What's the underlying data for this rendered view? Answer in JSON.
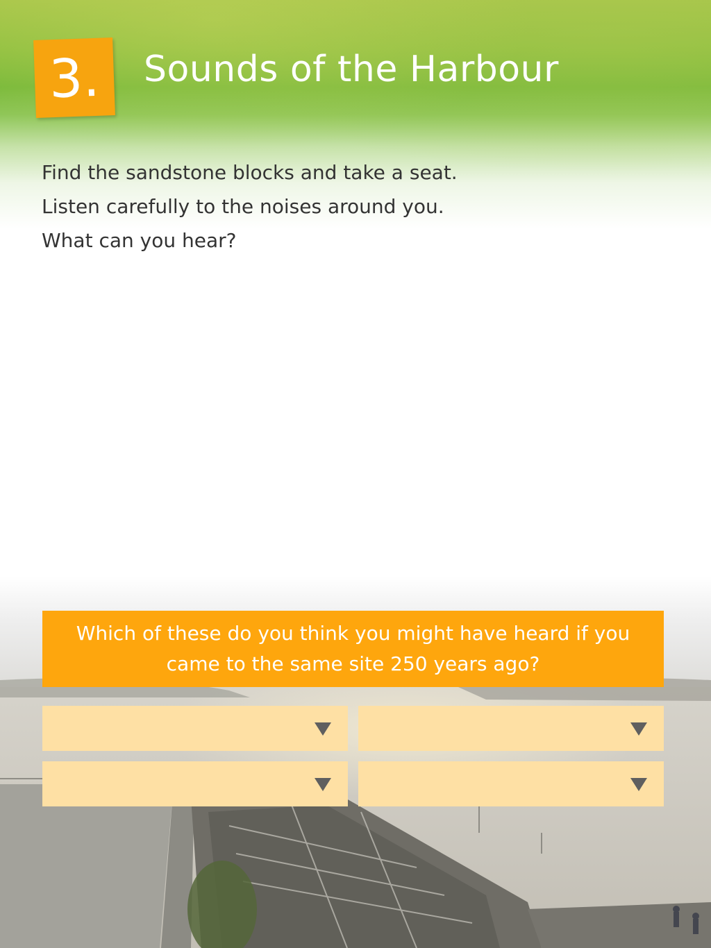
{
  "header": {
    "number": "3.",
    "title": "Sounds of the Harbour"
  },
  "instructions": [
    "Find the sandstone blocks and take a seat.",
    "Listen carefully to the noises around you.",
    "What can you hear?"
  ],
  "question": {
    "text": "Which of these do you think you might have heard if you came to the same site 250 years ago?"
  },
  "answers": [
    {
      "value": "",
      "icon": "chevron-down-icon"
    },
    {
      "value": "",
      "icon": "chevron-down-icon"
    },
    {
      "value": "",
      "icon": "chevron-down-icon"
    },
    {
      "value": "",
      "icon": "chevron-down-icon"
    }
  ],
  "colors": {
    "badge": "#f7a40f",
    "banner": "#fea60d",
    "dropdown": "#fee0a4",
    "header_green": "#78b93a"
  }
}
